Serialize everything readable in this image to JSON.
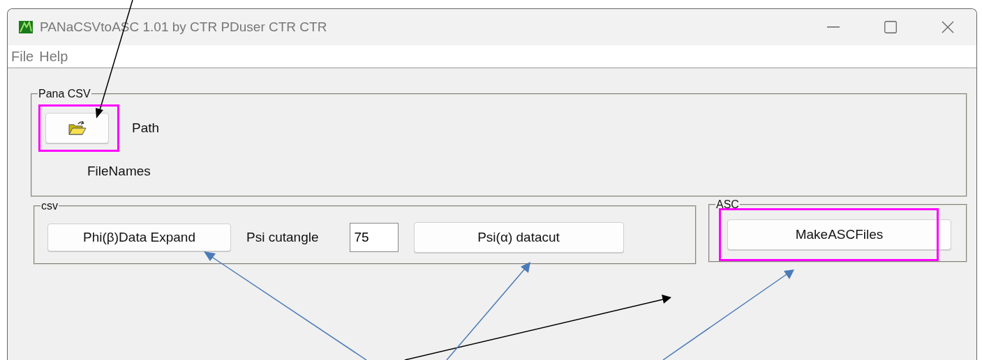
{
  "window": {
    "title": "PANaCSVtoASC 1.01 by CTR PDuser CTR CTR"
  },
  "menu": [
    "File",
    "Help"
  ],
  "pana_csv": {
    "legend": "Pana CSV",
    "path_label": "Path",
    "filenames_label": "FileNames"
  },
  "csv": {
    "legend": "csv",
    "expand_button": "Phi(β)Data Expand",
    "cutangle_label": "Psi cutangle",
    "cutangle_value": "75",
    "datacut_button": "Psi(α)  datacut"
  },
  "asc": {
    "legend": "ASC",
    "make_button": "MakeASCFiles"
  }
}
